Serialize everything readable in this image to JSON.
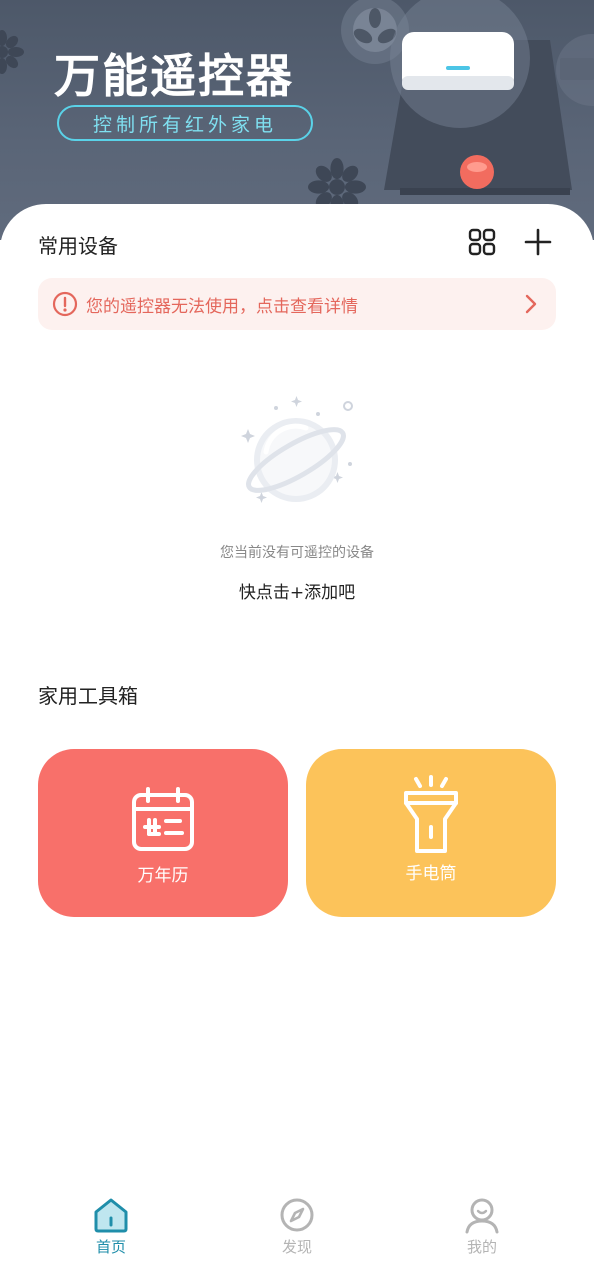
{
  "banner": {
    "title": "万能遥控器",
    "subtitle": "控制所有红外家电"
  },
  "devices": {
    "section_title": "常用设备",
    "warning_text": "您的遥控器无法使用，点击查看详情",
    "empty_message": "您当前没有可遥控的设备",
    "empty_action": "快点击+添加吧"
  },
  "toolbox": {
    "section_title": "家用工具箱",
    "tools": [
      {
        "label": "万年历",
        "icon": "calendar-icon",
        "color": "#f8706a"
      },
      {
        "label": "手电筒",
        "icon": "flashlight-icon",
        "color": "#fcc35a"
      }
    ]
  },
  "nav": {
    "items": [
      {
        "label": "首页",
        "icon": "home-icon",
        "active": true
      },
      {
        "label": "发现",
        "icon": "compass-icon",
        "active": false
      },
      {
        "label": "我的",
        "icon": "profile-icon",
        "active": false
      }
    ]
  },
  "colors": {
    "accent": "#1f8eaa",
    "warning": "#e4675c",
    "inactive": "#b4b4b4"
  }
}
